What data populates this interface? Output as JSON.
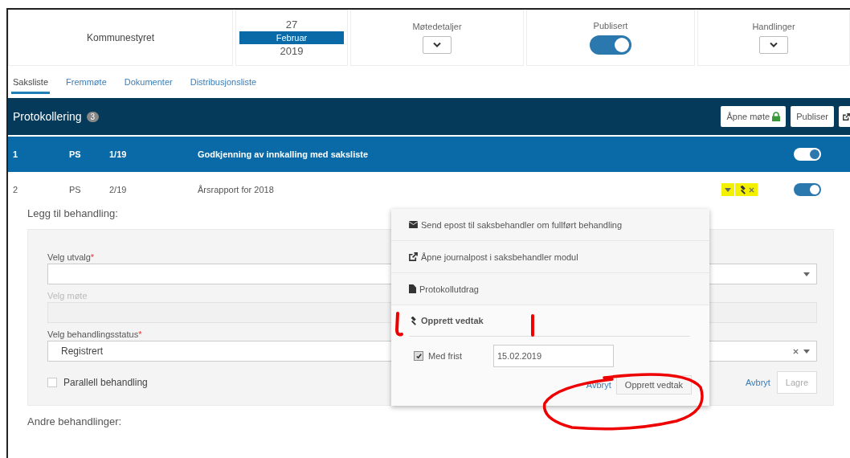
{
  "header": {
    "committee": "Kommunestyret",
    "date": {
      "day": "27",
      "month": "Februar",
      "year": "2019"
    },
    "details": {
      "label": "Møtedetaljer"
    },
    "published": {
      "label": "Publisert",
      "on": true
    },
    "actions": {
      "label": "Handlinger"
    }
  },
  "tabs": [
    {
      "label": "Saksliste",
      "selected": true
    },
    {
      "label": "Fremmøte",
      "selected": false
    },
    {
      "label": "Dokumenter",
      "selected": false
    },
    {
      "label": "Distribusjonsliste",
      "selected": false
    }
  ],
  "section": {
    "title": "Protokollering",
    "count": "3",
    "buttons": [
      {
        "label": "Åpne møte",
        "kind": "lock"
      },
      {
        "label": "Publiser",
        "kind": "plain"
      },
      {
        "kind": "icon"
      }
    ]
  },
  "rows": [
    {
      "number": "1",
      "type": "PS",
      "case": "1/19",
      "title": "Godkjenning av innkalling med saksliste",
      "selected": true,
      "on": true,
      "tools": false
    },
    {
      "number": "2",
      "type": "PS",
      "case": "2/19",
      "title": "Årsrapport for 2018",
      "selected": false,
      "on": true,
      "tools": true
    }
  ],
  "form": {
    "title": "Legg til behandling:",
    "required_mark": "*",
    "fields": [
      {
        "label": "Velg utvalg",
        "required": true,
        "disabled": false,
        "clearable": false
      },
      {
        "label": "Velg møte",
        "required": false,
        "disabled": true,
        "clearable": false
      },
      {
        "label": "Velg behandlingsstatus",
        "required": true,
        "disabled": false,
        "value": "Registrert",
        "clearable": true
      }
    ],
    "parallel": {
      "label": "Parallell behandling",
      "checked": false
    },
    "cancel": "Avbryt",
    "save": "Lagre"
  },
  "other_title": "Andre behandlinger:",
  "menu": {
    "items": [
      {
        "label": "Send epost til saksbehandler om fullført behandling",
        "kind": "mail"
      },
      {
        "label": "Åpne journalpost i saksbehandler modul",
        "kind": "link"
      },
      {
        "label": "Protokollutdrag",
        "kind": "file"
      },
      {
        "label": "Opprett vedtak",
        "kind": "gavel"
      }
    ],
    "deadline": {
      "label": "Med frist",
      "checked": true,
      "value": "15.02.2019"
    },
    "cancel": "Avbryt",
    "submit": "Opprett vedtak"
  }
}
